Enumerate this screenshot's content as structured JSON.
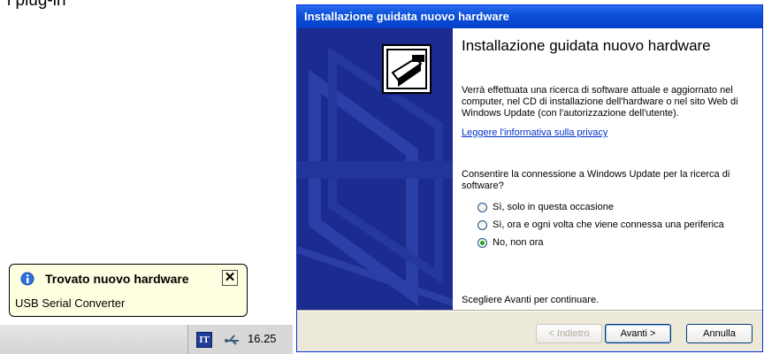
{
  "clipped_text": "l  plug-in",
  "wizard": {
    "title": "Installazione guidata nuovo hardware",
    "heading": "Installazione guidata nuovo hardware",
    "intro": "Verrà effettuata una ricerca di software attuale e aggiornato nel computer, nel CD di installazione dell'hardware o nel sito Web di Windows Update (con l'autorizzazione dell'utente).",
    "privacy_link": "Leggere l'informativa sulla privacy",
    "question": "Consentire la connessione a Windows Update per la ricerca di software?",
    "options": [
      {
        "label": "Sì, solo in questa occasione",
        "checked": false
      },
      {
        "label": "Sì, ora e ogni volta che viene connessa una periferica",
        "checked": false
      },
      {
        "label": "No, non ora",
        "checked": true
      }
    ],
    "continue_text": "Scegliere Avanti per continuare.",
    "buttons": {
      "back": "< Indietro",
      "next": "Avanti >",
      "cancel": "Annulla"
    }
  },
  "balloon": {
    "title": "Trovato nuovo hardware",
    "body": "USB Serial Converter",
    "close": "✕"
  },
  "taskbar": {
    "language": "IT",
    "clock": "16.25"
  },
  "icons": {
    "banner": "hardware-install-icon",
    "balloon": "info-icon",
    "tray": "usb-icon"
  }
}
